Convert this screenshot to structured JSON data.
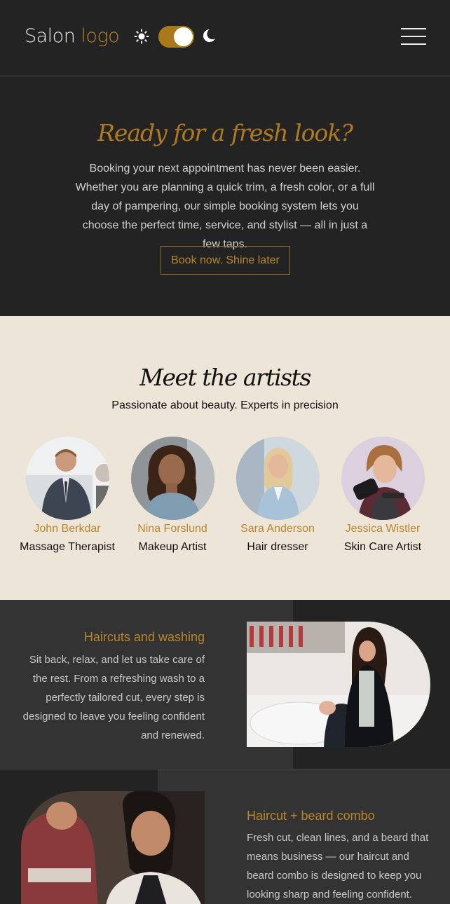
{
  "header": {
    "logo_part1": "Salon",
    "logo_part2": "logo",
    "theme_toggle_state": "dark",
    "icons": [
      "sun-icon",
      "moon-icon",
      "menu-icon"
    ]
  },
  "hero": {
    "title": "Ready for a fresh look?",
    "text": "Booking your next appointment has never been easier. Whether you are planning a quick trim, a fresh color, or a full day of pampering, our simple booking system lets you choose the perfect time, service, and stylist — all in just a few taps.",
    "button_label": "Book now. Shine later"
  },
  "artists": {
    "title": "Meet the artists",
    "subtitle": "Passionate about beauty. Experts in precision",
    "items": [
      {
        "name": "John Berkdar",
        "role": "Massage Therapist"
      },
      {
        "name": "Nina Forslund",
        "role": "Makeup Artist"
      },
      {
        "name": "Sara Anderson",
        "role": "Hair dresser"
      },
      {
        "name": "Jessica Wistler",
        "role": "Skin Care Artist"
      }
    ]
  },
  "services": [
    {
      "title": "Haircuts and washing",
      "text": "Sit back, relax, and let us take care of the rest. From a refreshing wash to a perfectly tailored cut, every step is designed to leave you feeling confident and renewed."
    },
    {
      "title": "Haircut + beard combo",
      "text": "Fresh cut, clean lines, and a beard that means business — our haircut and beard combo is designed to keep you looking sharp and feeling confident."
    }
  ],
  "colors": {
    "accent": "#b8862b",
    "dark_bg": "#232323",
    "section_bg": "#333333",
    "light_bg": "#ede5d8"
  }
}
